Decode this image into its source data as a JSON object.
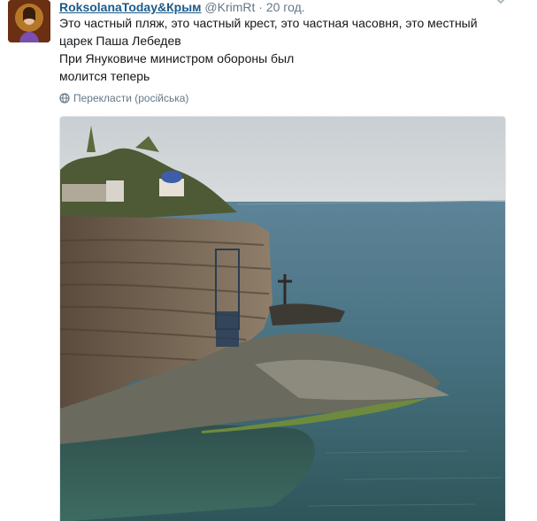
{
  "tweet": {
    "author_name": "RoksolanaToday&Крым",
    "author_handle": "@KrimRt",
    "separator": "·",
    "timestamp": "20 год.",
    "text_lines": [
      "Это частный пляж, это частный крест, это частная часовня, это местный",
      "царек Паша Лебедев",
      "При Януковиче министром обороны был",
      "молится теперь"
    ],
    "translate_label": "Перекласти (російська)",
    "avatar_icon": "avatar-portrait-icon",
    "caret_icon": "chevron-down-icon",
    "globe_icon": "globe-icon",
    "photo_subject": "Rocky coastline cliff with chapel and cross over the sea"
  },
  "colors": {
    "link": "#1b5b8a",
    "secondary": "#657786",
    "sea": "#3f6a7e"
  }
}
